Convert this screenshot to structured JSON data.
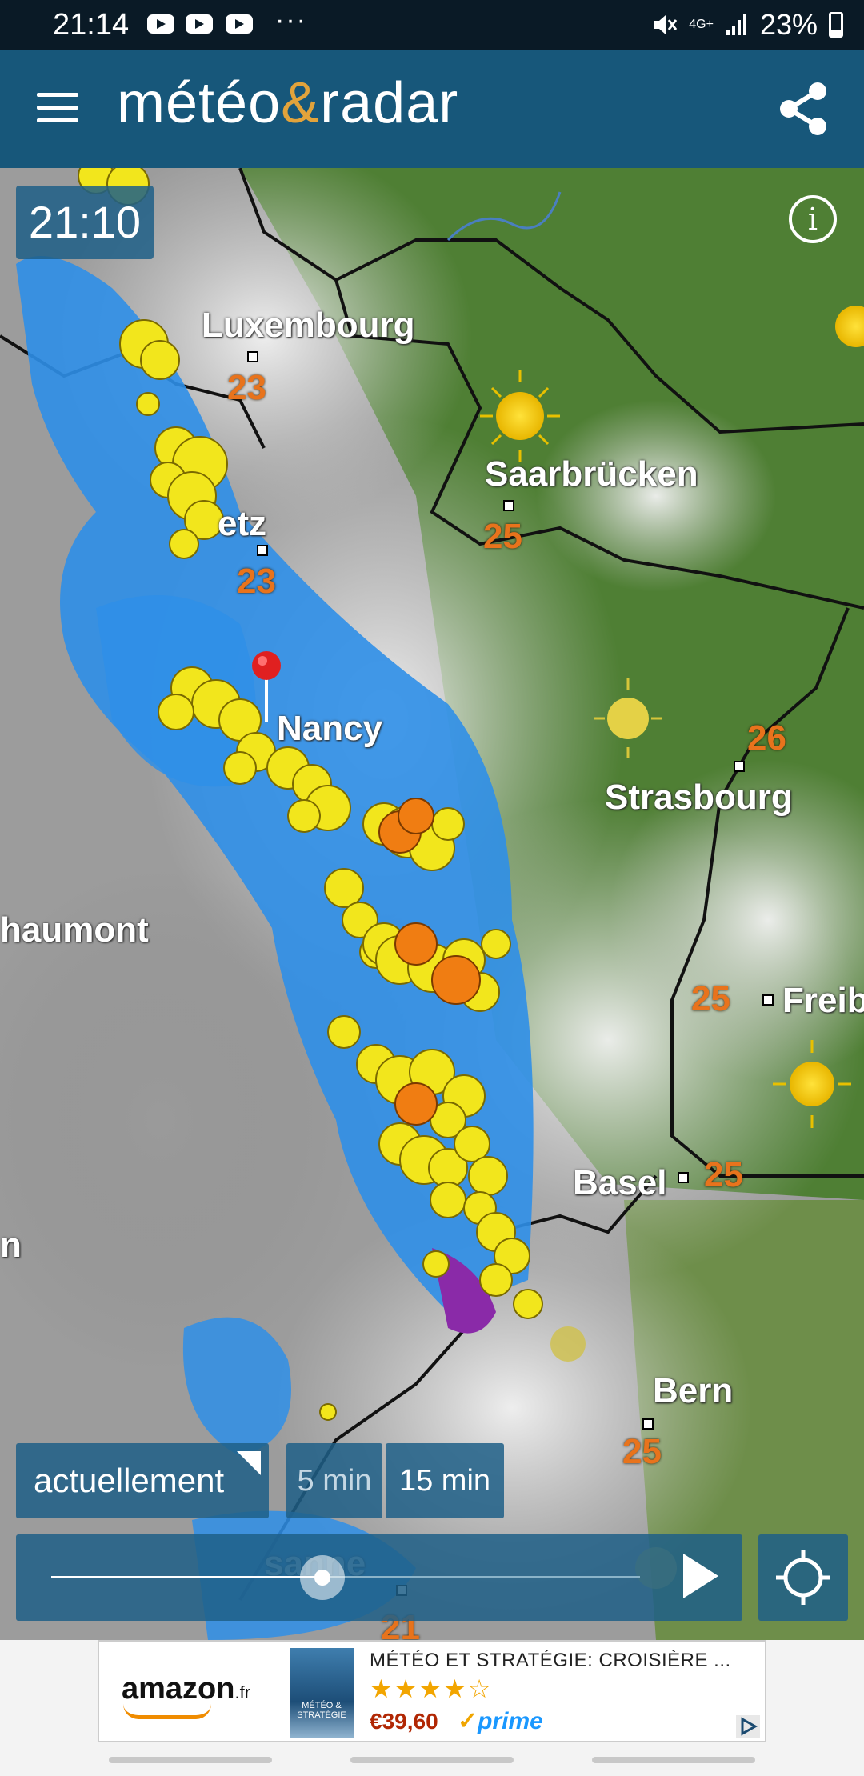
{
  "status_bar": {
    "time": "21:14",
    "more": "···",
    "network": "4G+",
    "battery": "23%"
  },
  "app_bar": {
    "logo_part1": "météo",
    "logo_amp": "&",
    "logo_part2": "radar",
    "menu_icon": "hamburger-menu-icon",
    "share_icon": "share-icon"
  },
  "map": {
    "timestamp": "21:10",
    "info_label": "i",
    "cities": [
      {
        "name": "Luxembourg",
        "temp": "23"
      },
      {
        "name": "Saarbrücken",
        "temp": "25"
      },
      {
        "name": "etz",
        "temp": "23"
      },
      {
        "name": "Nancy",
        "temp": ""
      },
      {
        "name": "Strasbourg",
        "temp": "26"
      },
      {
        "name": "haumont",
        "temp": ""
      },
      {
        "name": "Freib",
        "temp": "25"
      },
      {
        "name": "Basel",
        "temp": "25"
      },
      {
        "name": "Bern",
        "temp": "25"
      },
      {
        "name": "n",
        "temp": ""
      },
      {
        "name": "sanne",
        "temp": "21"
      }
    ]
  },
  "controls": {
    "now_label": "actuellement",
    "step_5": "5 min",
    "step_15": "15 min",
    "progress": 0.46,
    "play_icon": "play-icon",
    "locate_icon": "crosshair-location-icon"
  },
  "ad": {
    "brand": "amazon",
    "brand_tld": ".fr",
    "book_cover_text": "MÉTÉO & STRATÉGIE",
    "title": "MÉTÉO ET STRATÉGIE: CROISIÈRE ...",
    "stars": "★★★★☆",
    "price": "€39,60",
    "prime_check": "✓",
    "prime": "prime"
  },
  "colors": {
    "app_bar": "#17577a",
    "logo_amp": "#e2a33b",
    "temp": "#e8731c",
    "rain": "#2f8fe8",
    "storm": "#f2e61c",
    "severe": "#f07d12"
  }
}
